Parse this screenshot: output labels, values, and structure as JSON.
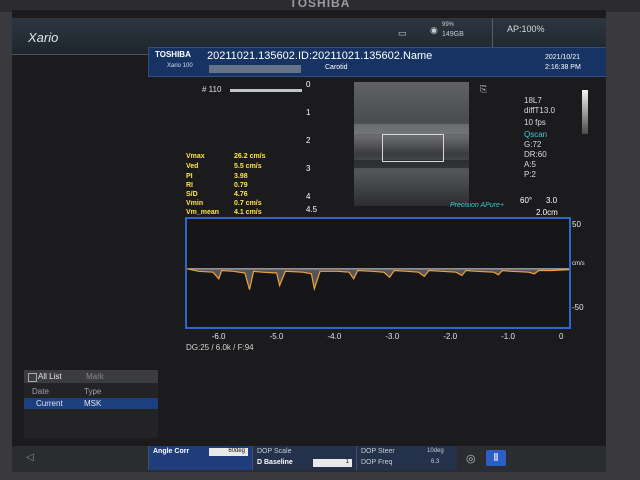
{
  "bezel": {
    "brand": "TOSHIBA"
  },
  "header": {
    "app_name": "Xario",
    "storage_pct": "99%",
    "storage_size": "149GB",
    "ap_label": "AP:100%"
  },
  "patient_bar": {
    "brand": "TOSHIBA",
    "model": "Xario 100",
    "id_line": "20211021.135602.ID:20211021.135602.Name",
    "region": "Carotid",
    "date": "2021/10/21",
    "time": "2:16:38 PM"
  },
  "bmode": {
    "frame_no": "# 110",
    "depth_marks": [
      "0",
      "1",
      "2",
      "3",
      "4",
      "4.5"
    ]
  },
  "right_params": {
    "probe": "18L7",
    "preset": "diffT13.0",
    "fps": "10 fps",
    "scan": "Qscan",
    "gain": "G:72",
    "dr": "DR:60",
    "a": "A:5",
    "p": "P:2"
  },
  "measurements": [
    {
      "name": "Vmax",
      "value": "26.2 cm/s"
    },
    {
      "name": "Ved",
      "value": "5.5 cm/s"
    },
    {
      "name": "PI",
      "value": "3.98"
    },
    {
      "name": "RI",
      "value": "0.79"
    },
    {
      "name": "S/D",
      "value": "4.76"
    },
    {
      "name": "Vmin",
      "value": "0.7 cm/s"
    },
    {
      "name": "Vm_mean",
      "value": "4.1 cm/s"
    }
  ],
  "doppler_info": {
    "precision": "Precision",
    "apure": "APure+",
    "angle": "60°",
    "gate": "3.0",
    "depth": "2.0cm"
  },
  "chart_data": {
    "type": "line",
    "title": "",
    "xlabel": "",
    "ylabel": "cm/s",
    "x_ticks": [
      "-6.0",
      "-5.0",
      "-4.0",
      "-3.0",
      "-2.0",
      "-1.0",
      "0"
    ],
    "y_ticks": [
      "50",
      "-50"
    ],
    "xlim": [
      -6.6,
      0
    ],
    "ylim": [
      -70,
      60
    ],
    "series": [
      {
        "x": [
          -6.6,
          -6.4,
          -6.15,
          -6.05,
          -6.0,
          -5.8,
          -5.6,
          -5.52,
          -5.45,
          -5.3,
          -5.05,
          -5.0,
          -4.9,
          -4.6,
          -4.45,
          -4.4,
          -4.3,
          -4.0,
          -3.8,
          -3.72,
          -3.65,
          -3.4,
          -3.2,
          -3.1,
          -3.02,
          -2.8,
          -2.6,
          -2.5,
          -2.42,
          -2.2,
          -1.95,
          -1.85,
          -1.78,
          -1.6,
          -1.3,
          -1.22,
          -1.15,
          -1.0,
          -0.7,
          -0.6,
          -0.52,
          -0.3,
          0
        ],
        "y": [
          0,
          -3,
          -4,
          -12,
          -2,
          -3,
          -5,
          -25,
          -3,
          -4,
          -5,
          -20,
          -3,
          -4,
          -6,
          -24,
          -3,
          -3,
          -4,
          -12,
          -2,
          -3,
          -4,
          -10,
          -2,
          -3,
          -4,
          -9,
          -2,
          -3,
          -4,
          -8,
          -2,
          -3,
          -4,
          -7,
          -2,
          -3,
          -4,
          -6,
          -2,
          -2,
          -1
        ]
      }
    ]
  },
  "velocity_unit": "cm/s",
  "doppler_settings": {
    "dg": "DG:25",
    "prf": "6.0k",
    "filter": "F:94"
  },
  "list_panel": {
    "all_list": "All List",
    "mark": "Mark",
    "col_date": "Date",
    "col_type": "Type",
    "row_current": "Current",
    "row_value": "MSK"
  },
  "bottom_bar": {
    "angle_corr": "Angle Corr",
    "angle_val": "60deg",
    "dop_scale": "DOP Scale",
    "d_baseline": "D Baseline",
    "baseline_val": "1",
    "dop_steer": "DOP Steer",
    "steer_val": "10deg",
    "dop_freq": "DOP Freq",
    "freq_val": "6.3"
  }
}
